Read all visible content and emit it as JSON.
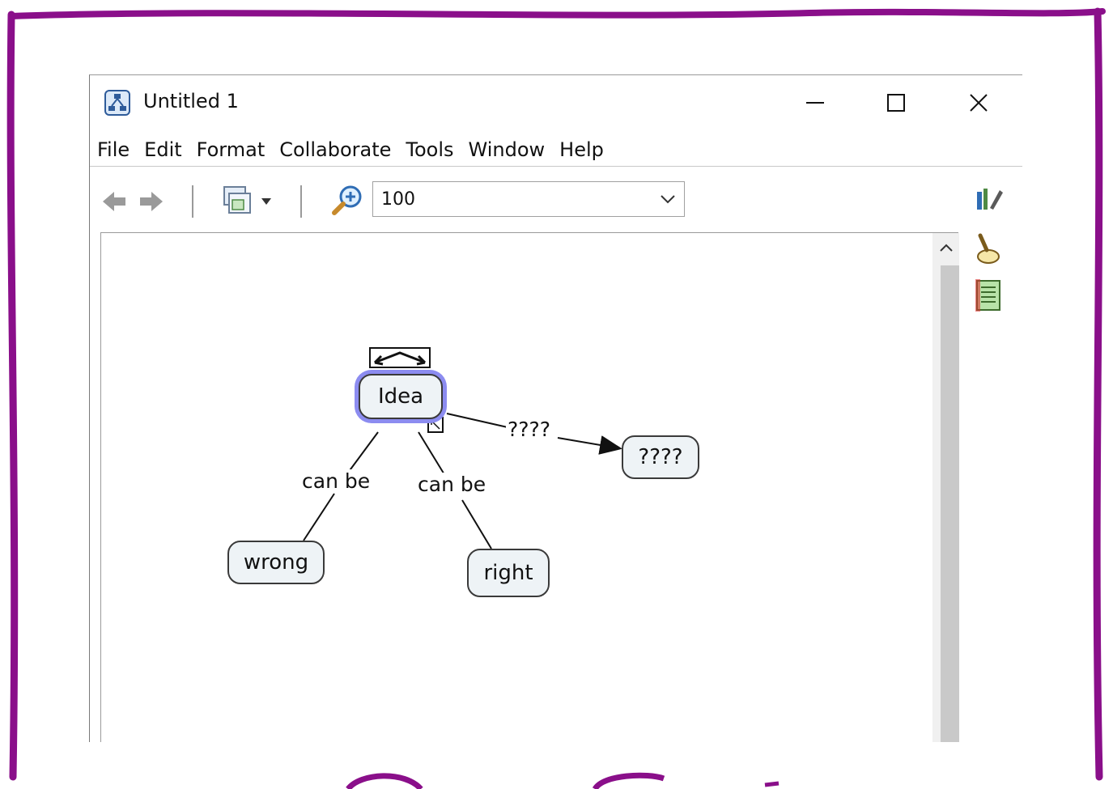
{
  "window": {
    "title": "Untitled 1",
    "minimize_glyph": "—",
    "maximize_glyph": "☐",
    "close_glyph": "✕"
  },
  "menu": {
    "items": [
      "File",
      "Edit",
      "Format",
      "Collaborate",
      "Tools",
      "Window",
      "Help"
    ]
  },
  "toolbar": {
    "zoom_value": "100",
    "icons": [
      "back-arrow-icon",
      "forward-arrow-icon",
      "view-menu-icon",
      "zoom-in-icon",
      "chevron-down-icon"
    ]
  },
  "side_tools": {
    "icons": [
      "styles-icon",
      "find-icon",
      "notes-icon"
    ]
  },
  "concept_map": {
    "nodes": {
      "idea": "Idea",
      "unknown": "????",
      "wrong": "wrong",
      "right": "right"
    },
    "links": {
      "idea_to_unknown": "????",
      "idea_to_wrong": "can be",
      "idea_to_right": "can be"
    }
  },
  "colors": {
    "frame": "#8a0f8a",
    "selection": "#8c8cf0",
    "node_fill": "#eef3f6"
  }
}
